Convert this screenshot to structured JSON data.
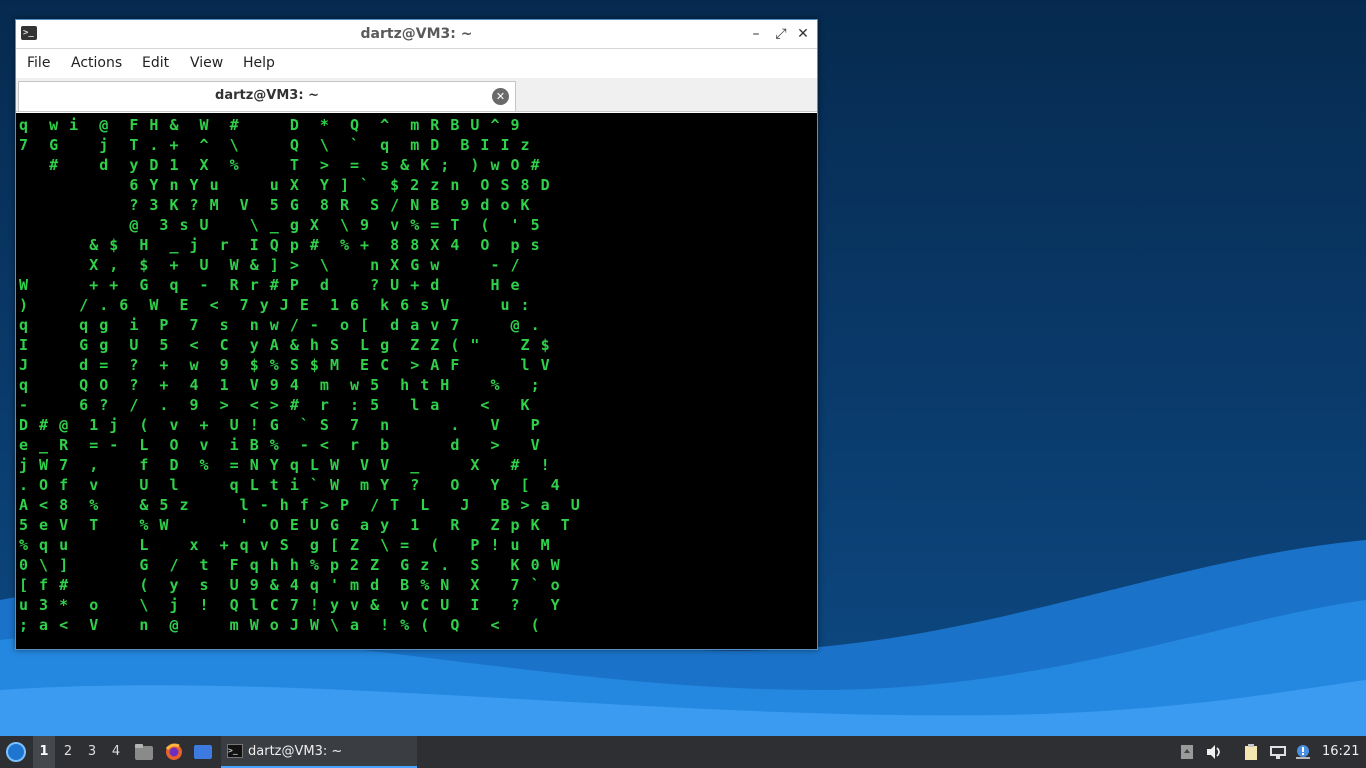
{
  "window": {
    "title": "dartz@VM3: ~",
    "minimize": "–",
    "maximize": "⤢",
    "close": "✕",
    "menu": [
      "File",
      "Actions",
      "Edit",
      "View",
      "Help"
    ],
    "tab_label": "dartz@VM3: ~",
    "tab_close": "✕"
  },
  "terminal": {
    "text_color": "#2fd14a",
    "lines": [
      "q  w i  @  F H &  W  #     D  *  Q  ^  m R B U ^ 9  ",
      "7  G    j  T . +  ^  \\     Q  \\  `  q  m D  B I I z",
      "   #    d  y D 1  X  %     T  >  =  s & K ;  ) w O #",
      "           6 Y n Y u     u X  Y ] `  $ 2 z n  O S 8 D",
      "           ? 3 K ? M  V  5 G  8 R  S / N B  9 d o K",
      "           @  3 s U    \\ _ g X  \\ 9  v % = T  (  ' 5",
      "       & $  H  _ j  r  I Q p #  % +  8 8 X 4  O  p s",
      "       X ,  $  +  U  W & ] >  \\    n X G w     - /",
      "W      + +  G  q  -  R r # P  d    ? U + d     H e",
      ")     / . 6  W  E  <  7 y J E  1 6  k 6 s V     u :",
      "q     q g  i  P  7  s  n w / -  o [  d a v 7     @ .",
      "I     G g  U  5  <  C  y A & h S  L g  Z Z ( \"    Z $",
      "J     d =  ?  +  w  9  $ % S $ M  E C  > A F      l V",
      "q     Q O  ?  +  4  1  V 9 4  m  w 5  h t H    %   ;",
      "-     6 ?  /  .  9  >  < > #  r  : 5   l a    <   K",
      "D # @  1 j  (  v  +  U ! G  ` S  7  n      .   V   P",
      "e _ R  = -  L  O  v  i B %  - <  r  b      d   >   V",
      "j W 7  ,    f  D  %  = N Y q L W  V V  _     X   #  !",
      ". O f  v    U  l     q L t i ` W  m Y  ?   O   Y  [  4",
      "A < 8  %    & 5 z     l - h f > P  / T  L   J   B > a  U",
      "5 e V  T    % W       '  O E U G  a y  1   R   Z p K  T",
      "% q u       L    x  + q v S  g [ Z  \\ =  (   P ! u  M",
      "0 \\ ]       G  /  t  F q h h % p 2 Z  G z .  S   K 0 W",
      "[ f #       (  y  s  U 9 & 4 q ' m d  B % N  X   7 ` o",
      "u 3 *  o    \\  j  !  Q l C 7 ! y v &  v C U  I   ?   Y",
      "; a <  V    n  @     m W o J W \\ a  ! % (  Q   <   ("
    ]
  },
  "taskbar": {
    "workspaces": [
      "1",
      "2",
      "3",
      "4"
    ],
    "task_label": "dartz@VM3: ~",
    "clock": "16:21"
  }
}
